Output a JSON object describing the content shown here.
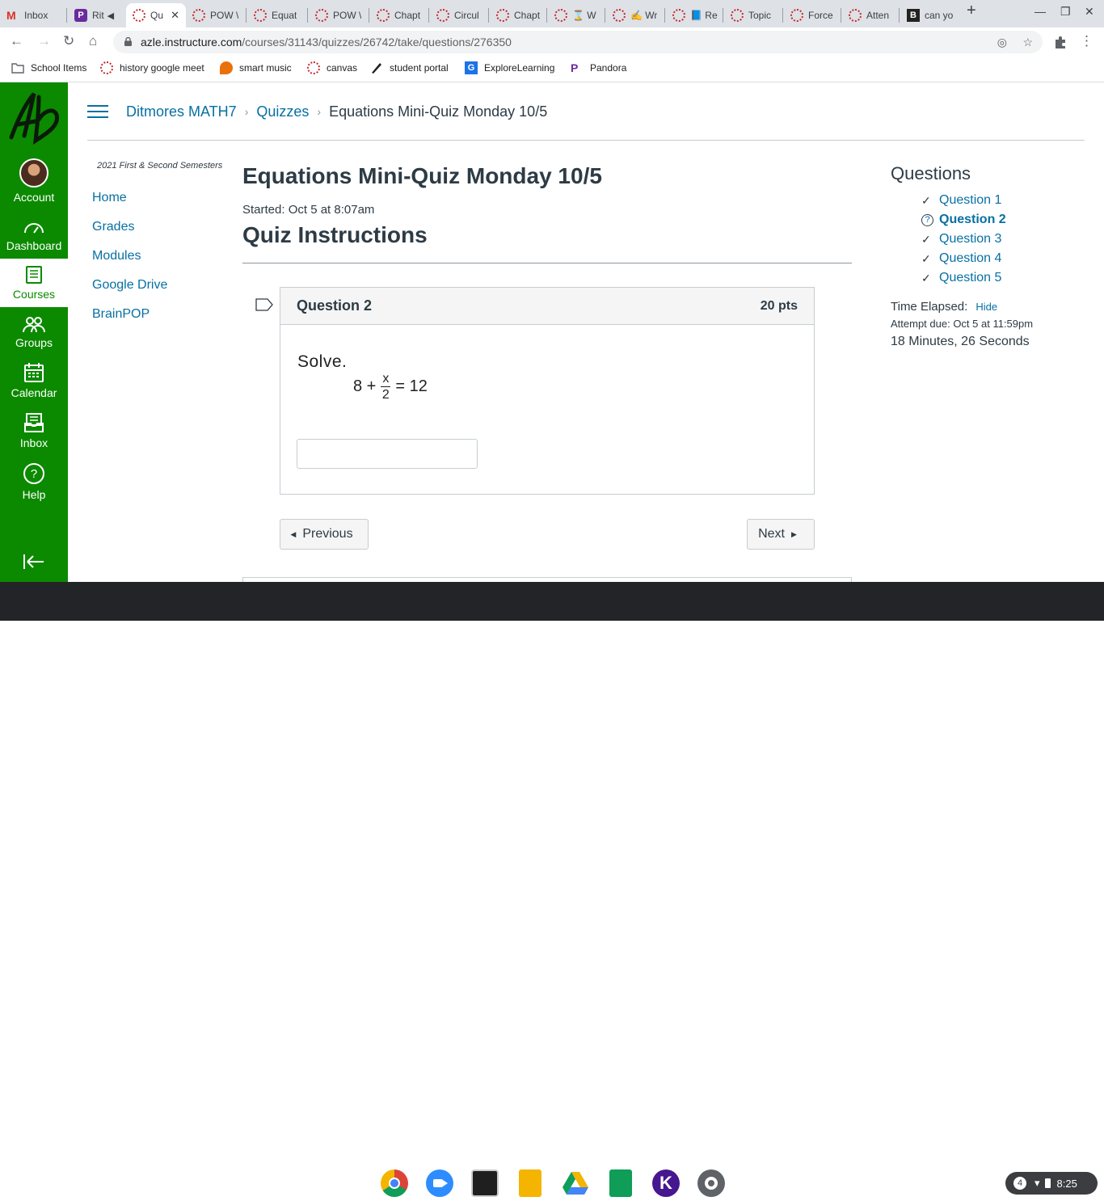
{
  "browser": {
    "tabs": [
      {
        "title": "Inbox",
        "favicon": "gmail-icon"
      },
      {
        "title": "Rit",
        "favicon": "p-icon"
      },
      {
        "title": "Qu",
        "favicon": "canvas-icon",
        "active": true
      },
      {
        "title": "POW \\",
        "favicon": "canvas-icon"
      },
      {
        "title": "Equat",
        "favicon": "canvas-icon"
      },
      {
        "title": "POW \\",
        "favicon": "canvas-icon"
      },
      {
        "title": "Chapt",
        "favicon": "canvas-icon"
      },
      {
        "title": "Circul",
        "favicon": "canvas-icon"
      },
      {
        "title": "Chapt",
        "favicon": "canvas-icon"
      },
      {
        "title": "⌛ W",
        "favicon": "canvas-icon"
      },
      {
        "title": "✍ Wr",
        "favicon": "canvas-icon"
      },
      {
        "title": "📘 Re",
        "favicon": "canvas-icon"
      },
      {
        "title": "Topic",
        "favicon": "canvas-icon"
      },
      {
        "title": "Force",
        "favicon": "canvas-icon"
      },
      {
        "title": "Atten",
        "favicon": "canvas-icon"
      },
      {
        "title": "can yo",
        "favicon": "b-icon"
      }
    ],
    "url_host": "azle.instructure.com",
    "url_path": "/courses/31143/quizzes/26742/take/questions/276350",
    "bookmarks": [
      {
        "label": "School Items",
        "icon": "folder-icon"
      },
      {
        "label": "history google meet",
        "icon": "canvas-icon"
      },
      {
        "label": "smart music",
        "icon": "smartmusic-icon"
      },
      {
        "label": "canvas",
        "icon": "canvas-icon"
      },
      {
        "label": "student portal",
        "icon": "portal-icon"
      },
      {
        "label": "ExploreLearning",
        "icon": "explorelearning-icon"
      },
      {
        "label": "Pandora",
        "icon": "pandora-icon"
      }
    ]
  },
  "global_nav": {
    "account": "Account",
    "dashboard": "Dashboard",
    "courses": "Courses",
    "groups": "Groups",
    "calendar": "Calendar",
    "inbox": "Inbox",
    "help": "Help"
  },
  "breadcrumb": {
    "course": "Ditmores MATH7",
    "quizzes": "Quizzes",
    "current": "Equations Mini-Quiz Monday 10/5"
  },
  "course_nav": {
    "term": "2021 First & Second Semesters",
    "items": [
      "Home",
      "Grades",
      "Modules",
      "Google Drive",
      "BrainPOP"
    ]
  },
  "quiz": {
    "title": "Equations Mini-Quiz Monday 10/5",
    "started": "Started: Oct 5 at 8:07am",
    "instructions_heading": "Quiz Instructions",
    "question": {
      "name": "Question 2",
      "points": "20 pts",
      "prompt": "Solve.",
      "eq_left": "8 +",
      "eq_num": "x",
      "eq_den": "2",
      "eq_right": "= 12",
      "answer_value": ""
    },
    "prev_label": "Previous",
    "next_label": "Next"
  },
  "sidebar": {
    "title": "Questions",
    "questions": [
      {
        "label": "Question 1",
        "state": "answered"
      },
      {
        "label": "Question 2",
        "state": "current"
      },
      {
        "label": "Question 3",
        "state": "answered"
      },
      {
        "label": "Question 4",
        "state": "answered"
      },
      {
        "label": "Question 5",
        "state": "answered"
      }
    ],
    "time_elapsed_label": "Time Elapsed:",
    "hide_label": "Hide",
    "attempt_due": "Attempt due: Oct 5 at 11:59pm",
    "elapsed_value": "18 Minutes, 26 Seconds"
  },
  "shelf": {
    "notification_count": "4",
    "time": "8:25"
  },
  "colors": {
    "nav_green": "#0b8a00",
    "link_blue": "#0770a3",
    "text": "#2d3b45"
  }
}
